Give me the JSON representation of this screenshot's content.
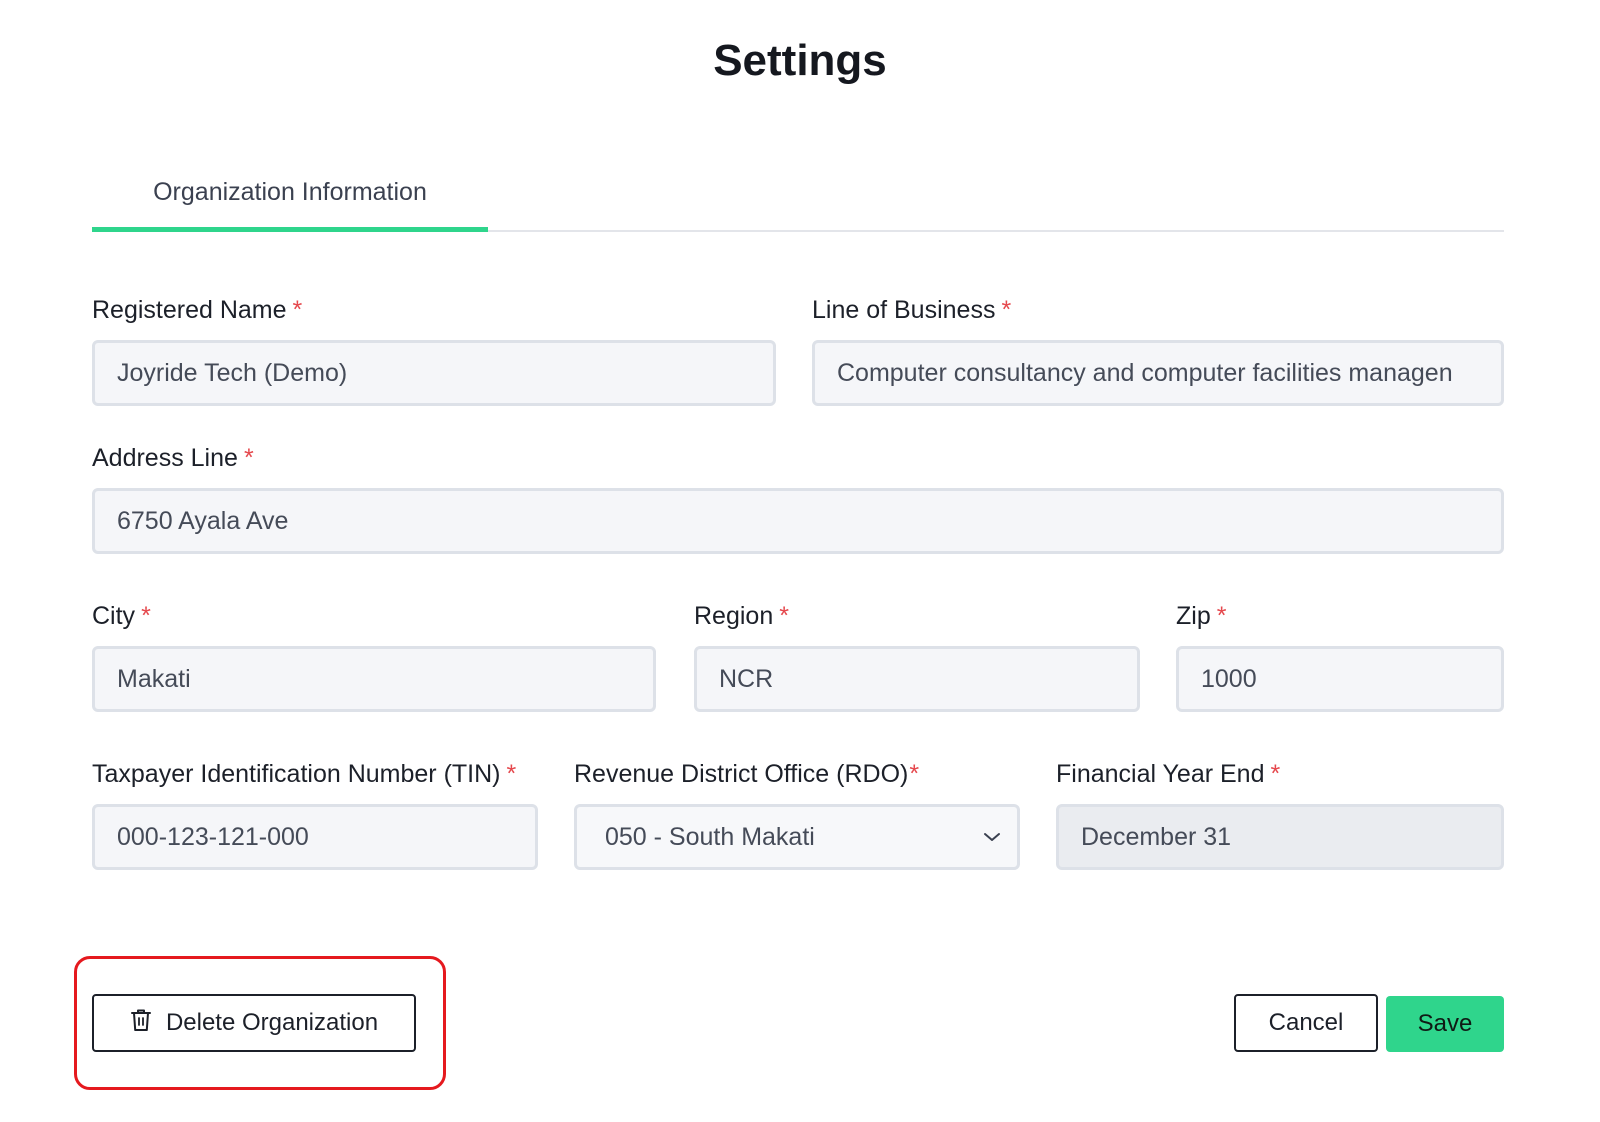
{
  "page": {
    "title": "Settings"
  },
  "tabs": [
    {
      "label": "Organization Information",
      "active": true
    }
  ],
  "form": {
    "registered_name": {
      "label": "Registered Name",
      "value": "Joyride Tech (Demo)"
    },
    "line_of_business": {
      "label": "Line of Business",
      "value": "Computer consultancy and computer facilities managen"
    },
    "address_line": {
      "label": "Address Line",
      "value": "6750 Ayala Ave"
    },
    "city": {
      "label": "City",
      "value": "Makati"
    },
    "region": {
      "label": "Region",
      "value": "NCR"
    },
    "zip": {
      "label": "Zip",
      "value": "1000"
    },
    "tin": {
      "label": "Taxpayer Identification Number (TIN)",
      "value": "000-123-121-000"
    },
    "rdo": {
      "label": "Revenue District Office (RDO)",
      "selected": "050 - South Makati"
    },
    "financial_year_end": {
      "label": "Financial Year End",
      "value": "December 31"
    },
    "required_marker": "*"
  },
  "actions": {
    "delete_label": "Delete Organization",
    "cancel_label": "Cancel",
    "save_label": "Save"
  },
  "colors": {
    "accent": "#2fd58c",
    "required": "#e5484d",
    "highlight_outline": "#e5191e",
    "input_bg": "#f5f6f9",
    "input_border": "#dde1e8"
  },
  "icons": {
    "delete": "trash-icon",
    "select": "chevron-down-icon"
  }
}
